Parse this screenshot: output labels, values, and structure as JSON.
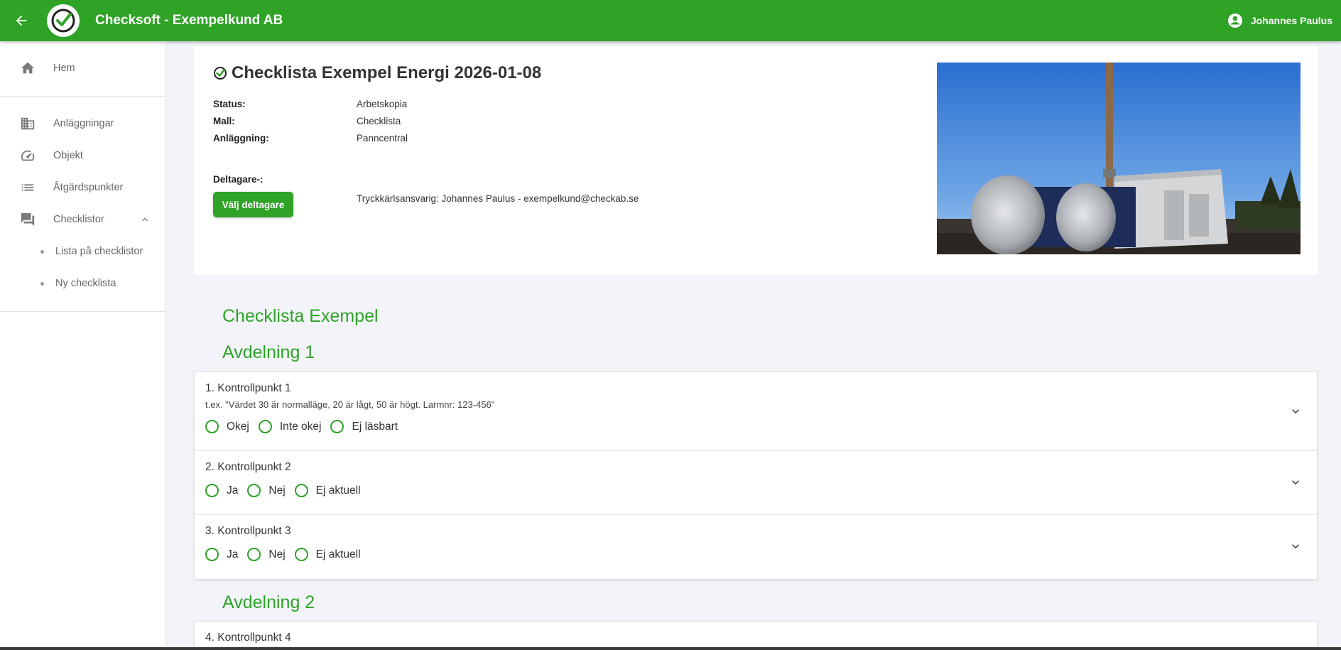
{
  "header": {
    "app_title": "Checksoft - Exempelkund AB",
    "user_name": "Johannes Paulus",
    "icons": {
      "back": "arrow-left-icon",
      "logo": "checkmark-logo",
      "user": "account-circle-icon"
    }
  },
  "sidebar": {
    "items": [
      {
        "label": "Hem",
        "icon": "home-icon"
      },
      {
        "label": "Anläggningar",
        "icon": "building-icon"
      },
      {
        "label": "Objekt",
        "icon": "speedometer-icon"
      },
      {
        "label": "Åtgärdspunkter",
        "icon": "list-icon"
      },
      {
        "label": "Checklistor",
        "icon": "chat-icon",
        "expanded": true
      },
      {
        "label": "Lista på checklistor"
      },
      {
        "label": "Ny checklista"
      }
    ]
  },
  "document": {
    "title": "Checklista Exempel Energi 2026-01-08",
    "status_label": "Status:",
    "status_value": "Arbetskopia",
    "template_label": "Mall:",
    "template_value": "Checklista",
    "facility_label": "Anläggning:",
    "facility_value": "Panncentral",
    "participants_label": "Deltagare-:",
    "choose_participants_button": "Välj deltagare",
    "responsible": "Tryckkärlsansvarig: Johannes Paulus - exempelkund@checkab.se"
  },
  "checklist": {
    "name": "Checklista Exempel",
    "sections": [
      {
        "title": "Avdelning 1",
        "points": [
          {
            "title": "1. Kontrollpunkt 1",
            "hint": "t.ex. \"Värdet 30 är normalläge, 20 är lågt, 50 är högt. Larmnr: 123-456\"",
            "options": [
              "Okej",
              "Inte okej",
              "Ej läsbart"
            ]
          },
          {
            "title": "2. Kontrollpunkt 2",
            "options": [
              "Ja",
              "Nej",
              "Ej aktuell"
            ]
          },
          {
            "title": "3. Kontrollpunkt 3",
            "options": [
              "Ja",
              "Nej",
              "Ej aktuell"
            ]
          }
        ]
      },
      {
        "title": "Avdelning 2",
        "points": [
          {
            "title": "4. Kontrollpunkt 4"
          }
        ]
      }
    ]
  },
  "colors": {
    "brand_green": "#2ea326",
    "page_bg": "#f3f4fa"
  }
}
